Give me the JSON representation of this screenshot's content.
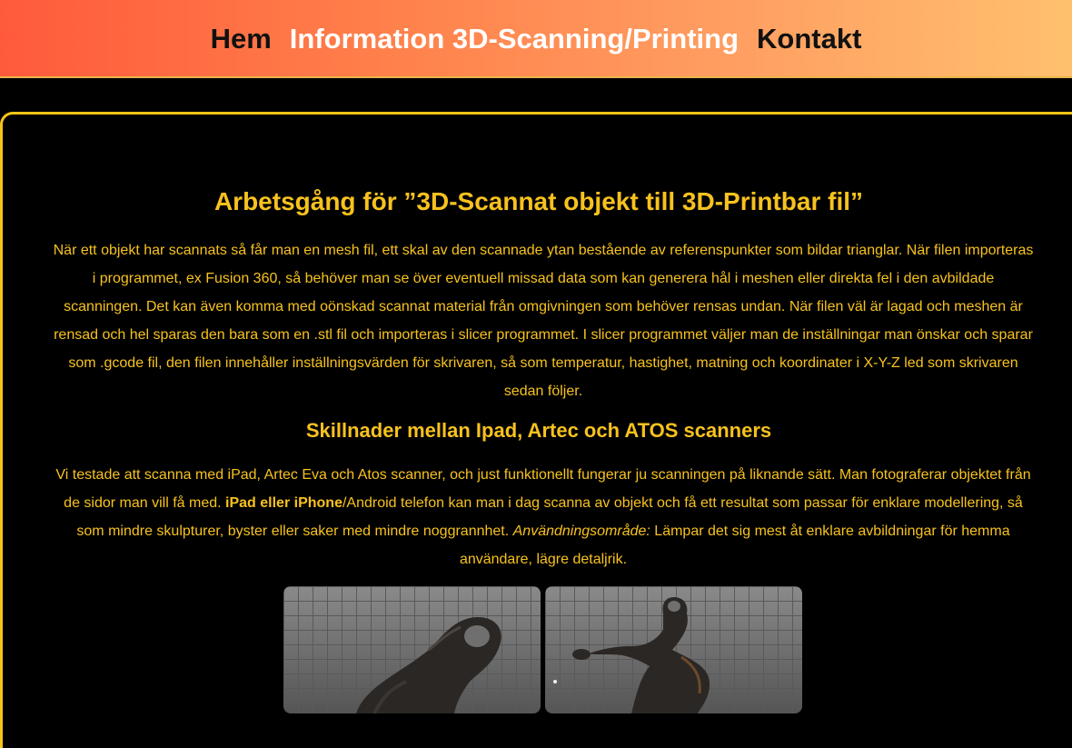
{
  "nav": {
    "home": "Hem",
    "info": "Information 3D-Scanning/Printing",
    "contact": "Kontakt"
  },
  "main": {
    "title": "Arbetsgång för ”3D-Scannat objekt till 3D-Printbar fil”",
    "intro": "När ett objekt har scannats så får man en mesh fil, ett skal av den scannade ytan bestående av referenspunkter som bildar trianglar. När filen importeras i programmet, ex Fusion 360, så behöver man se över eventuell missad data som kan generera hål i meshen eller direkta fel i den avbildade scanningen. Det kan även komma med oönskad scannat material från omgivningen som behöver rensas undan. När filen väl är lagad och meshen är rensad och hel sparas den bara som en .stl fil och importeras i slicer programmet. I slicer programmet väljer man de inställningar man önskar och sparar som .gcode fil, den filen innehåller inställningsvärden för skrivaren, så som temperatur, hastighet, matning och koordinater i X-Y-Z led som skrivaren sedan följer.",
    "subtitle": "Skillnader mellan Ipad, Artec och ATOS scanners",
    "scanners_p1": "Vi testade att scanna med iPad, Artec Eva och Atos scanner, och just funktionellt fungerar ju scanningen på liknande sätt. Man fotograferar objektet från de sidor man vill få med. ",
    "scanners_bold": "iPad eller iPhone",
    "scanners_p2": "/Android telefon kan man i dag scanna av objekt och få ett resultat som passar för enklare modellering, så som mindre skulpturer, byster eller saker med mindre noggrannhet. ",
    "scanners_italic": "Användningsområde:",
    "scanners_p3": " Lämpar det sig mest åt enklare avbildningar för hemma användare, lägre detaljrik."
  },
  "colors": {
    "accent": "#f7c21e",
    "nav_gradient_start": "#ff5a3c",
    "nav_gradient_end": "#ffc06e",
    "background": "#000000"
  }
}
